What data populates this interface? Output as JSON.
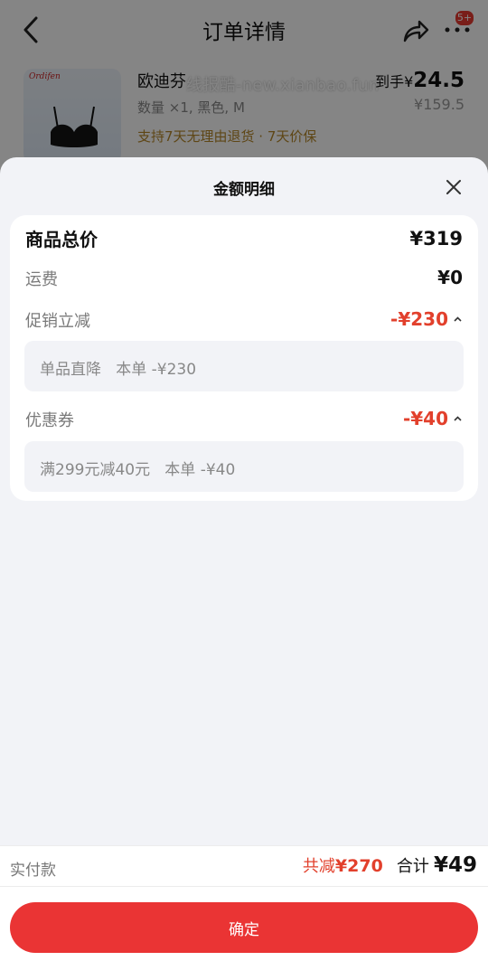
{
  "page": {
    "title": "订单详情",
    "badge": "5+"
  },
  "product": {
    "name": "欧迪芬",
    "watermark": "线报酷-new.xianbao.fun",
    "spec": "数量 ×1, 黑色, M",
    "service": "支持7天无理由退货 · 7天价保",
    "price_prefix": "到手¥",
    "price": "24.5",
    "original_price": "¥159.5",
    "thumb_brand": "Ordifen"
  },
  "sheet": {
    "title": "金额明细",
    "rows": {
      "total": {
        "label": "商品总价",
        "amount": "¥319"
      },
      "shipping": {
        "label": "运费",
        "amount": "¥0"
      },
      "promo": {
        "label": "促销立减",
        "amount": "-¥230",
        "detail": "单品直降   本单 -¥230"
      },
      "coupon": {
        "label": "优惠券",
        "amount": "-¥40",
        "detail": "满299元减40元   本单 -¥40"
      }
    }
  },
  "footer": {
    "pay_label": "实付款",
    "saved_label": "共减",
    "saved_amount": "¥270",
    "total_label": "合计",
    "total_amount": "¥49",
    "confirm_label": "确定"
  },
  "colors": {
    "accent": "#ea3434",
    "discount": "#e2402c",
    "service": "#b5872a"
  },
  "icons": {
    "back": "chevron-left-icon",
    "share": "share-icon",
    "more": "more-icon",
    "close": "close-icon",
    "caret": "caret-up-icon"
  }
}
